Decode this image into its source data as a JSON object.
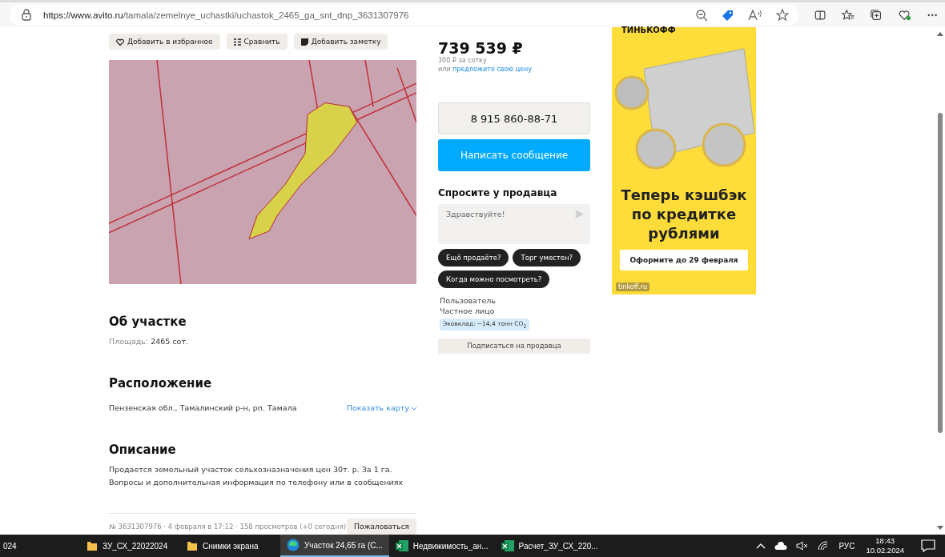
{
  "browser": {
    "url_host": "https://www.avito.ru",
    "url_path": "/tamala/zemelnye_uchastki/uchastok_2465_ga_snt_dnp_3631307976"
  },
  "actions": [
    {
      "kind": "favorite",
      "label": "Добавить в избранное"
    },
    {
      "kind": "compare",
      "label": "Сравнить"
    },
    {
      "kind": "note",
      "label": "Добавить заметку"
    }
  ],
  "price": {
    "amount": "739 539 ₽",
    "per_unit": "300 ₽ за сотку",
    "offer_prefix": "или",
    "offer_link": "предложите свою цену"
  },
  "phone_button": "8 915 860-88-71",
  "message_button": "Написать сообщение",
  "ask": {
    "title": "Спросите у продавца",
    "placeholder": "Здравствуйте!",
    "chips": [
      "Ещё продаёте?",
      "Торг уместен?",
      "Когда можно посмотреть?"
    ]
  },
  "seller": {
    "name": "Пользователь",
    "type": "Частное лицо",
    "eco_badge": "Эковклад: −14,4 тонн CO$_{2}$",
    "subscribe_button": "Подписаться на продавца"
  },
  "about": {
    "title": "Об участке",
    "area_label": "Площадь:",
    "area_value": "2465 сот."
  },
  "location": {
    "title": "Расположение",
    "address": "Пензенская обл., Тамалинский р-н, рп. Тамала",
    "map_link": "Показать карту"
  },
  "description": {
    "title": "Описание",
    "text": "Продается земельный участок сельхозназначения цен 30т. р. За 1 га. Вопросы и дополнительная информация по телефону или в сообщениях"
  },
  "footer": {
    "meta": "№ 3631307976 · 4 февраля в 17:12 · 158 просмотров (+0 сегодня)",
    "report_button": "Пожаловаться"
  },
  "ad": {
    "brand": "ТИНЬКОФФ",
    "headline": "Теперь кэшбэк по кредитке рублями",
    "cta": "Оформите до 29 февраля",
    "domain": "tinkoff.ru"
  },
  "taskbar": {
    "items": [
      {
        "kind": "text",
        "label": "024",
        "selected": false
      },
      {
        "kind": "folder",
        "label": "ЗУ_СХ_22022024",
        "selected": false
      },
      {
        "kind": "folder",
        "label": "Снимки экрана",
        "selected": false
      },
      {
        "kind": "browser",
        "label": "Участок 24,65 га (С...",
        "selected": true
      },
      {
        "kind": "excel",
        "label": "Недвижимость_ан...",
        "selected": false
      },
      {
        "kind": "excel",
        "label": "Расчет_ЗУ_СХ_220...",
        "selected": false
      }
    ],
    "language": "РУС",
    "time": "18:43",
    "date": "10.02.2024"
  }
}
